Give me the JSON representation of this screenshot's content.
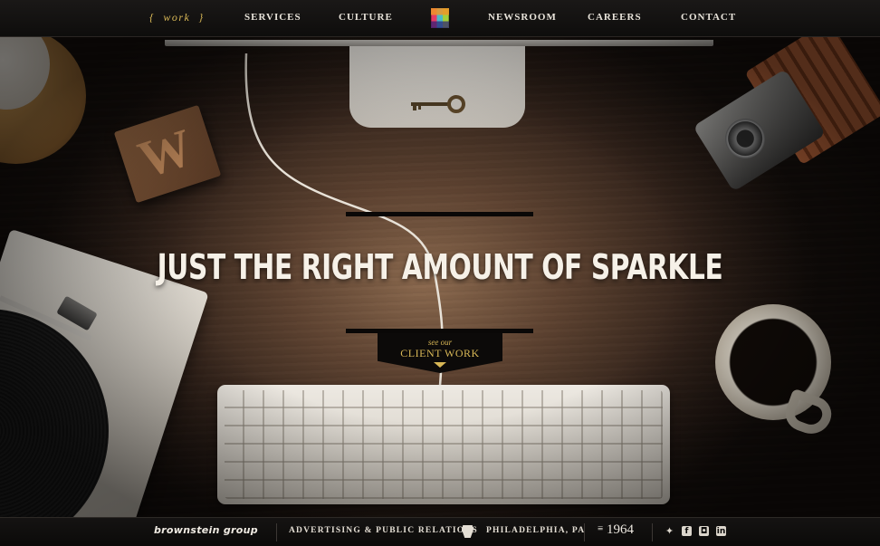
{
  "nav": {
    "work": "work",
    "brace_open": "{",
    "brace_close": "}",
    "services": "SERVICES",
    "culture": "CULTURE",
    "newsroom": "NEWSROOM",
    "careers": "CAREERS",
    "contact": "CONTACT",
    "logo_icon": "color-square-logo-icon"
  },
  "hero": {
    "headline": "JUST THE RIGHT AMOUNT OF SPARKLE",
    "block_letter": "W",
    "cta_small": "see our",
    "cta_big": "CLIENT WORK"
  },
  "footer": {
    "brand": "brownstein group",
    "tagline": "ADVERTISING & PUBLIC RELATIONS",
    "location": "PHILADELPHIA, PA",
    "year": "1964",
    "year_prefix": "≡",
    "social": {
      "twitter": "twitter-icon",
      "facebook": "facebook-icon",
      "instagram": "instagram-icon",
      "linkedin": "linkedin-icon"
    }
  },
  "colors": {
    "accent": "#d8b756",
    "nav_bg": "#141211",
    "headline": "#f6f1e8"
  }
}
